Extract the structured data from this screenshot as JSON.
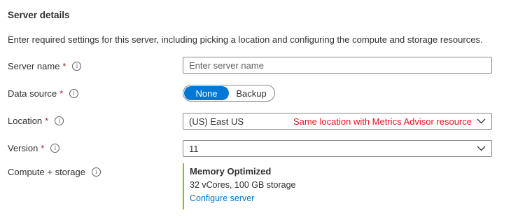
{
  "section": {
    "title": "Server details",
    "description": "Enter required settings for this server, including picking a location and configuring the compute and storage resources."
  },
  "fields": {
    "server_name": {
      "label": "Server name",
      "required_mark": "*",
      "info_icon": "i",
      "placeholder": "Enter server name",
      "value": ""
    },
    "data_source": {
      "label": "Data source",
      "required_mark": "*",
      "info_icon": "i",
      "options": [
        "None",
        "Backup"
      ],
      "selected": "None"
    },
    "location": {
      "label": "Location",
      "required_mark": "*",
      "info_icon": "i",
      "value": "(US) East US",
      "annotation": "Same location with Metrics Advisor resource"
    },
    "version": {
      "label": "Version",
      "required_mark": "*",
      "info_icon": "i",
      "value": "11"
    },
    "compute_storage": {
      "label": "Compute + storage",
      "info_icon": "i",
      "tier": "Memory Optimized",
      "detail": "32 vCores, 100 GB storage",
      "link": "Configure server"
    }
  },
  "colors": {
    "accent": "#0078d4",
    "required": "#a4262c",
    "annotation": "#e81123",
    "summary_bar": "#8cbd18",
    "border": "#8a8886"
  },
  "icons": {
    "info": "info-icon",
    "dropdown": "chevron-down-icon"
  }
}
